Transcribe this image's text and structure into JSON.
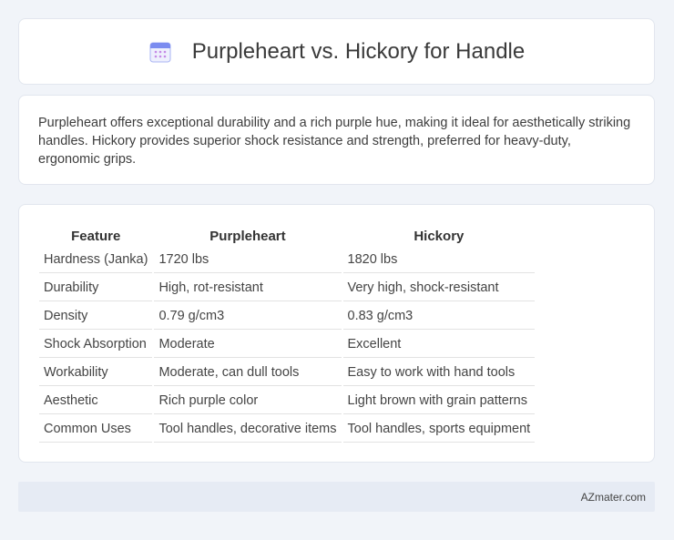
{
  "header": {
    "title": "Purpleheart vs. Hickory for Handle",
    "icon": "calendar-icon",
    "icon_color": "#7b8cf0"
  },
  "summary": {
    "text": "Purpleheart offers exceptional durability and a rich purple hue, making it ideal for aesthetically striking handles. Hickory provides superior shock resistance and strength, preferred for heavy-duty, ergonomic grips."
  },
  "comparison": {
    "columns": [
      "Feature",
      "Purpleheart",
      "Hickory"
    ],
    "rows": [
      [
        "Hardness (Janka)",
        "1720 lbs",
        "1820 lbs"
      ],
      [
        "Durability",
        "High, rot-resistant",
        "Very high, shock-resistant"
      ],
      [
        "Density",
        "0.79 g/cm3",
        "0.83 g/cm3"
      ],
      [
        "Shock Absorption",
        "Moderate",
        "Excellent"
      ],
      [
        "Workability",
        "Moderate, can dull tools",
        "Easy to work with hand tools"
      ],
      [
        "Aesthetic",
        "Rich purple color",
        "Light brown with grain patterns"
      ],
      [
        "Common Uses",
        "Tool handles, decorative items",
        "Tool handles, sports equipment"
      ]
    ]
  },
  "footer": {
    "brand": "AZmater.com"
  }
}
